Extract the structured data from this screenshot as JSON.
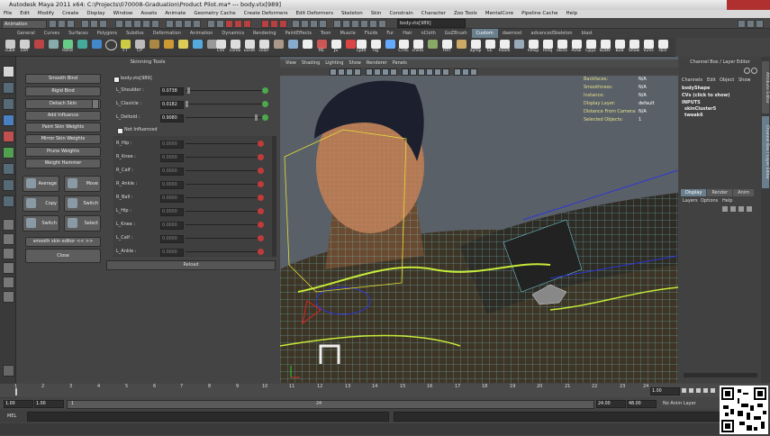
{
  "window": {
    "title": "Autodesk Maya 2011 x64: C:\\Projects\\070008-Graduation\\Product Pilot.ma* --- body.vtx[989]"
  },
  "menubar": {
    "items": [
      "File",
      "Edit",
      "Modify",
      "Create",
      "Display",
      "Window",
      "Assets",
      "Animate",
      "Geometry Cache",
      "Create Deformers",
      "Edit Deformers",
      "Skeleton",
      "Skin",
      "Constrain",
      "Character",
      "Zoo Tools",
      "MentalCore",
      "Pipeline Cache",
      "Help"
    ]
  },
  "status": {
    "mode": "Animation",
    "selection_field": "body.vtx[989]"
  },
  "shelf_tabs": {
    "items": [
      "General",
      "Curves",
      "Surfaces",
      "Polygons",
      "Subdivs",
      "Deformation",
      "Animation",
      "Dynamics",
      "Rendering",
      "PaintEffects",
      "Toon",
      "Muscle",
      "Fluids",
      "Fur",
      "Hair",
      "nCloth",
      "GoZBrush",
      "Custom",
      "daemost",
      "advancedSkeleton",
      "blast"
    ],
    "active": "Custom"
  },
  "shelf_buttons": [
    "cube",
    "LRA",
    "",
    "",
    "Hshd",
    "",
    "",
    "",
    "FT",
    "CP",
    "",
    "",
    "",
    "",
    "",
    "CVs",
    "comb",
    "uvset",
    "color",
    "",
    "",
    "",
    "",
    "",
    "",
    "RE",
    "JS",
    "",
    "Cptd",
    "rig",
    "",
    "CTRL",
    "chess",
    "",
    "Hfrl",
    "",
    "dymp",
    "EE",
    "hoodi",
    "",
    "nmsp",
    "Rsfq",
    "skinx",
    "AvSk",
    "Cpy2",
    "B2BV",
    "B2B",
    "Show",
    "V2Vs",
    "skin"
  ],
  "skinning": {
    "title": "Skinning Tools",
    "buttons": [
      "Smooth Bind",
      "Rigid Bind",
      "Detach Skin",
      "Add Influence",
      "Paint Skin Weights",
      "Mirror Skin Weights",
      "Prune Weights",
      "Weight Hammer"
    ],
    "tools": [
      {
        "label": "Average",
        "icon": "average-icon"
      },
      {
        "label": "Move",
        "icon": "move-weights-icon"
      },
      {
        "label": "Copy",
        "icon": "copy-weights-icon"
      },
      {
        "label": "Switch",
        "icon": "switch-weights-icon"
      },
      {
        "label": "Switch",
        "icon": "switch-icon"
      },
      {
        "label": "Select",
        "icon": "select-icon"
      }
    ],
    "smooth_skin": "smooth skin editor << >>",
    "close": "Close",
    "vertex_label": "body.vtx[989]",
    "not_influenced": "Not Influenced",
    "reload": "Reload",
    "influences": [
      {
        "name": "L_Shoulder :",
        "value": "0.0738",
        "fraction": 0.07,
        "lock": "green"
      },
      {
        "name": "L_Clavicle :",
        "value": "0.0182",
        "fraction": 0.02,
        "lock": "green"
      },
      {
        "name": "L_Deltoid :",
        "value": "0.9080",
        "fraction": 0.91,
        "lock": "green"
      }
    ],
    "not_influenced_list": [
      {
        "name": "R_Hip :",
        "value": "0.0000"
      },
      {
        "name": "R_Knee :",
        "value": "0.0000"
      },
      {
        "name": "R_Calf :",
        "value": "0.0000"
      },
      {
        "name": "R_Ankle :",
        "value": "0.0000"
      },
      {
        "name": "R_Ball :",
        "value": "0.0000"
      },
      {
        "name": "L_Hip :",
        "value": "0.0000"
      },
      {
        "name": "L_Knee :",
        "value": "0.0000"
      },
      {
        "name": "L_Calf :",
        "value": "0.0000"
      },
      {
        "name": "L_Ankle :",
        "value": "0.0000"
      }
    ]
  },
  "viewport": {
    "menu": [
      "View",
      "Shading",
      "Lighting",
      "Show",
      "Renderer",
      "Panels"
    ],
    "hud": [
      {
        "k": "Backfaces:",
        "v": "N/A"
      },
      {
        "k": "Smoothness:",
        "v": "N/A"
      },
      {
        "k": "Instance:",
        "v": "N/A"
      },
      {
        "k": "Display Layer:",
        "v": "default"
      },
      {
        "k": "Distance From Camera:",
        "v": "N/A"
      },
      {
        "k": "Selected Objects:",
        "v": "1"
      }
    ]
  },
  "channel_box": {
    "header": "Channel Box / Layer Editor",
    "menu": [
      "Channels",
      "Edit",
      "Object",
      "Show"
    ],
    "object": "bodyShape",
    "cvs": "CVs (click to show)",
    "inputs_label": "INPUTS",
    "inputs": [
      "skinCluster5",
      "tweak6"
    ],
    "layer_tabs": [
      "Display",
      "Render",
      "Anim"
    ],
    "layer_menu": [
      "Layers",
      "Options",
      "Help"
    ]
  },
  "side_tabs": [
    "Attribute Editor",
    "Channel Box / Layer Editor"
  ],
  "timeline": {
    "ticks": [
      "1",
      "2",
      "3",
      "4",
      "5",
      "6",
      "7",
      "8",
      "9",
      "10",
      "11",
      "12",
      "13",
      "14",
      "15",
      "16",
      "17",
      "18",
      "19",
      "20",
      "21",
      "22",
      "23",
      "24"
    ],
    "current": "1.00"
  },
  "range": {
    "start": "1.00",
    "start2": "1.00",
    "slider_start": "1",
    "slider_end": "24",
    "end": "24.00",
    "end2": "48.00",
    "anim_layer": "No Anim Layer"
  },
  "command": {
    "label": "MEL"
  }
}
